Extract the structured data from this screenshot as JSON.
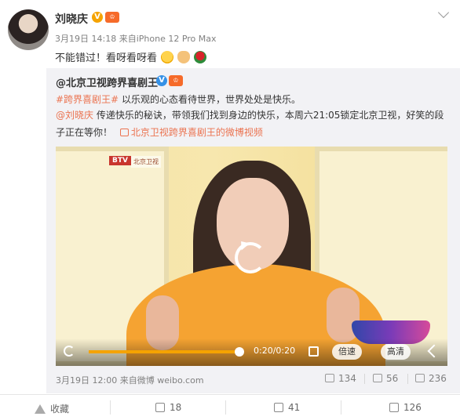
{
  "post": {
    "author": "刘晓庆",
    "verified_badge": "V",
    "level_badge": "♔",
    "timestamp": "3月19日 14:18",
    "source": "来自iPhone 12 Pro Max",
    "text": "不能错过！看呀看呀看"
  },
  "repost": {
    "author": "@北京卫视跨界喜剧王",
    "verified_badge": "V",
    "level_badge": "♔",
    "hashtag": "#跨界喜剧王#",
    "line1_rest": " 以乐观的心态看待世界，世界处处是快乐。",
    "mention": "@刘晓庆",
    "line2_rest": " 传递快乐的秘诀，带领我们找到身边的快乐，本周六21:05锁定北京卫视，好笑的段",
    "line3_text": "子正在等你！",
    "video_link": "北京卫视跨界喜剧王的微博视频",
    "video": {
      "channel_logo": "BTV",
      "channel_tag": "北京卫视",
      "time_display": "0:20/0:20",
      "progress": 1.0,
      "speed_label": "倍速",
      "quality_label": "高清"
    },
    "footer_time": "3月19日 12:00",
    "footer_source": "来自微博 weibo.com",
    "repost_count": "134",
    "comment_count": "56",
    "like_count": "236"
  },
  "actions": {
    "favorite_label": "收藏",
    "repost_count": "18",
    "comment_count": "41",
    "like_count": "126"
  },
  "colors": {
    "link": "#eb7350",
    "gold_badge": "#f5a300",
    "blue_badge": "#3591e6"
  }
}
